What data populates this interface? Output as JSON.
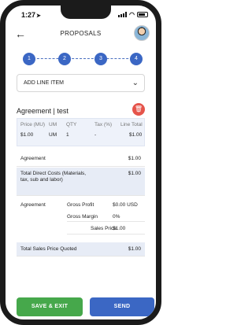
{
  "status_bar": {
    "time": "1:27",
    "location_icon": "location-arrow-icon"
  },
  "nav": {
    "title": "PROPOSALS"
  },
  "stepper": {
    "steps": [
      "1",
      "2",
      "3",
      "4"
    ]
  },
  "add_line_item": {
    "label": "ADD LINE ITEM"
  },
  "line_item": {
    "title": "Agreement | test",
    "headers": {
      "price": "Price (MU)",
      "um": "UM",
      "qty": "QTY",
      "tax": "Tax (%)",
      "total": "Line Total"
    },
    "values": {
      "price": "$1.00",
      "um": "UM",
      "qty": "1",
      "tax": "-",
      "total": "$1.00"
    }
  },
  "summary": {
    "agreement_label": "Agreement",
    "agreement_value": "$1.00",
    "total_direct_costs_label": "Total Direct Costs (Materials, tax, sub and labor)",
    "total_direct_costs_value": "$1.00",
    "agreement2_label": "Agreement",
    "gross_profit_label": "Gross Profit",
    "gross_profit_value": "$0.00 USD",
    "gross_margin_label": "Gross Margin",
    "gross_margin_value": "0%",
    "sales_price_label": "Sales Price",
    "sales_price_value": "$1.00",
    "total_sales_price_label": "Total Sales Price Quoted",
    "total_sales_price_value": "$1.00"
  },
  "buttons": {
    "save_exit": "SAVE & EXIT",
    "send": "SEND"
  },
  "colors": {
    "primary": "#3b67c4",
    "success": "#46a84b",
    "danger": "#e5544b",
    "shade": "#e7ecf6"
  }
}
